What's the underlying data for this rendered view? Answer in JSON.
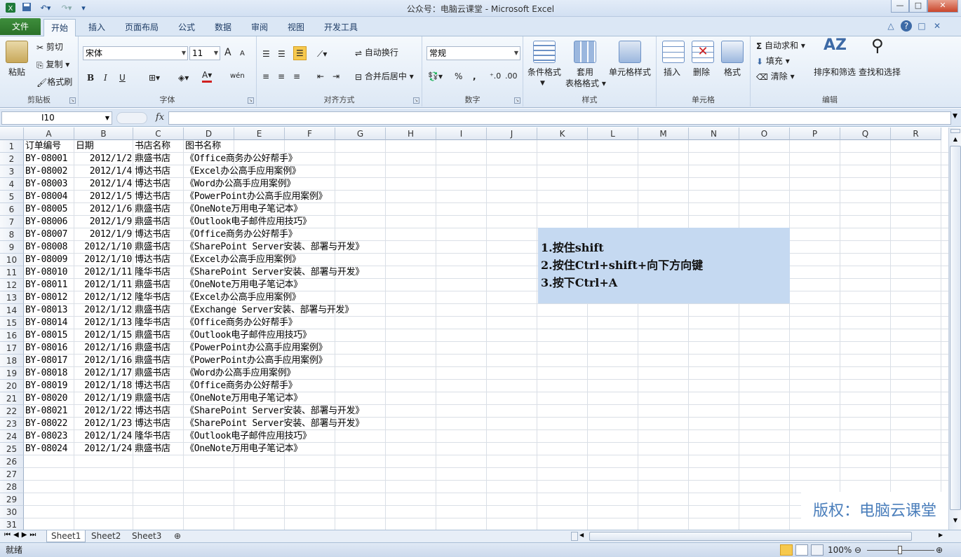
{
  "window": {
    "title": "公众号：电脑云课堂 - Microsoft Excel",
    "controls": [
      "—",
      "□",
      "✕"
    ],
    "ribbon_controls": [
      "△",
      "?",
      "□",
      "✕"
    ]
  },
  "tabs": [
    "文件",
    "开始",
    "插入",
    "页面布局",
    "公式",
    "数据",
    "审阅",
    "视图",
    "开发工具"
  ],
  "ribbon": {
    "clipboard": {
      "label": "剪贴板",
      "paste": "粘贴",
      "cut": "剪切",
      "copy": "复制",
      "painter": "格式刷"
    },
    "font": {
      "label": "字体",
      "name": "宋体",
      "size": "11",
      "bold": "B",
      "italic": "I",
      "underline": "U",
      "grow": "A",
      "shrink": "A",
      "wen": "wén"
    },
    "align": {
      "label": "对齐方式",
      "wrap": "自动换行",
      "merge": "合并后居中"
    },
    "number": {
      "label": "数字",
      "format": "常规",
      "percent": "%",
      "comma": ","
    },
    "styles": {
      "label": "样式",
      "cond": "条件格式",
      "table1": "套用",
      "table2": "表格格式",
      "cellstyle": "单元格样式"
    },
    "cells": {
      "label": "单元格",
      "insert": "插入",
      "delete": "删除",
      "format": "格式"
    },
    "editing": {
      "label": "编辑",
      "autosum": "自动求和",
      "fill": "填充",
      "clear": "清除",
      "sort": "排序和筛选",
      "find": "查找和选择"
    }
  },
  "formula_bar": {
    "name_box": "I10",
    "fx": "fx",
    "value": ""
  },
  "columns": [
    "A",
    "B",
    "C",
    "D",
    "E",
    "F",
    "G",
    "H",
    "I",
    "J",
    "K",
    "L",
    "M",
    "N",
    "O",
    "P",
    "Q",
    "R"
  ],
  "rows": [
    "1",
    "2",
    "3",
    "4",
    "5",
    "6",
    "7",
    "8",
    "9",
    "10",
    "11",
    "12",
    "13",
    "14",
    "15",
    "16",
    "17",
    "18",
    "19",
    "20",
    "21",
    "22",
    "23",
    "24",
    "25",
    "26",
    "27",
    "28",
    "29",
    "30",
    "31"
  ],
  "table": {
    "header": [
      "订单编号",
      "日期",
      "书店名称",
      "图书名称"
    ],
    "data": [
      [
        "BY-08001",
        "2012/1/2",
        "鼎盛书店",
        "《Office商务办公好帮手》"
      ],
      [
        "BY-08002",
        "2012/1/4",
        "博达书店",
        "《Excel办公高手应用案例》"
      ],
      [
        "BY-08003",
        "2012/1/4",
        "博达书店",
        "《Word办公高手应用案例》"
      ],
      [
        "BY-08004",
        "2012/1/5",
        "博达书店",
        "《PowerPoint办公高手应用案例》"
      ],
      [
        "BY-08005",
        "2012/1/6",
        "鼎盛书店",
        "《OneNote万用电子笔记本》"
      ],
      [
        "BY-08006",
        "2012/1/9",
        "鼎盛书店",
        "《Outlook电子邮件应用技巧》"
      ],
      [
        "BY-08007",
        "2012/1/9",
        "博达书店",
        "《Office商务办公好帮手》"
      ],
      [
        "BY-08008",
        "2012/1/10",
        "鼎盛书店",
        "《SharePoint Server安装、部署与开发》"
      ],
      [
        "BY-08009",
        "2012/1/10",
        "博达书店",
        "《Excel办公高手应用案例》"
      ],
      [
        "BY-08010",
        "2012/1/11",
        "隆华书店",
        "《SharePoint Server安装、部署与开发》"
      ],
      [
        "BY-08011",
        "2012/1/11",
        "鼎盛书店",
        "《OneNote万用电子笔记本》"
      ],
      [
        "BY-08012",
        "2012/1/12",
        "隆华书店",
        "《Excel办公高手应用案例》"
      ],
      [
        "BY-08013",
        "2012/1/12",
        "鼎盛书店",
        "《Exchange Server安装、部署与开发》"
      ],
      [
        "BY-08014",
        "2012/1/13",
        "隆华书店",
        "《Office商务办公好帮手》"
      ],
      [
        "BY-08015",
        "2012/1/15",
        "鼎盛书店",
        "《Outlook电子邮件应用技巧》"
      ],
      [
        "BY-08016",
        "2012/1/16",
        "鼎盛书店",
        "《PowerPoint办公高手应用案例》"
      ],
      [
        "BY-08017",
        "2012/1/16",
        "鼎盛书店",
        "《PowerPoint办公高手应用案例》"
      ],
      [
        "BY-08018",
        "2012/1/17",
        "鼎盛书店",
        "《Word办公高手应用案例》"
      ],
      [
        "BY-08019",
        "2012/1/18",
        "博达书店",
        "《Office商务办公好帮手》"
      ],
      [
        "BY-08020",
        "2012/1/19",
        "鼎盛书店",
        "《OneNote万用电子笔记本》"
      ],
      [
        "BY-08021",
        "2012/1/22",
        "博达书店",
        "《SharePoint Server安装、部署与开发》"
      ],
      [
        "BY-08022",
        "2012/1/23",
        "博达书店",
        "《SharePoint Server安装、部署与开发》"
      ],
      [
        "BY-08023",
        "2012/1/24",
        "隆华书店",
        "《Outlook电子邮件应用技巧》"
      ],
      [
        "BY-08024",
        "2012/1/24",
        "鼎盛书店",
        "《OneNote万用电子笔记本》"
      ]
    ]
  },
  "note": [
    "1.按住shift",
    "2.按住Ctrl+shift+向下方向键",
    "3.按下Ctrl+A"
  ],
  "watermark": "版权：电脑云课堂",
  "sheets": [
    "Sheet1",
    "Sheet2",
    "Sheet3"
  ],
  "status": {
    "ready": "就绪",
    "zoom": "100%"
  },
  "colors": {
    "note_fill": "#c5d9f1",
    "file_tab": "#2a7128",
    "watermark": "#4a7ebb"
  }
}
